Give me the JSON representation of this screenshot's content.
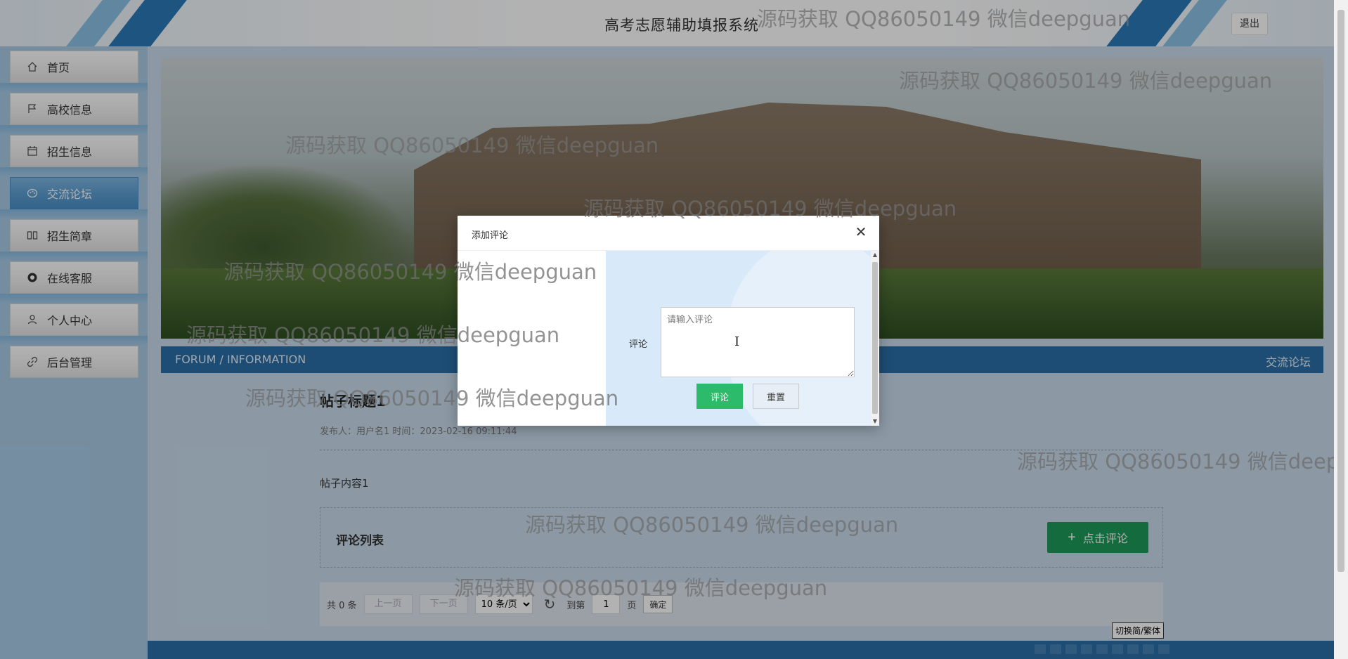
{
  "header": {
    "site_title": "高考志愿辅助填报系统",
    "logout_label": "退出"
  },
  "sidebar": {
    "items": [
      {
        "label": "首页",
        "icon": "home-icon",
        "active": false
      },
      {
        "label": "高校信息",
        "icon": "flag-icon",
        "active": false
      },
      {
        "label": "招生信息",
        "icon": "calendar-icon",
        "active": false
      },
      {
        "label": "交流论坛",
        "icon": "palette-icon",
        "active": true
      },
      {
        "label": "招生简章",
        "icon": "book-icon",
        "active": false
      },
      {
        "label": "在线客服",
        "icon": "chat-icon",
        "active": false
      },
      {
        "label": "个人中心",
        "icon": "user-icon",
        "active": false
      },
      {
        "label": "后台管理",
        "icon": "link-icon",
        "active": false
      }
    ]
  },
  "section": {
    "left_label": "FORUM / INFORMATION",
    "right_label": "交流论坛"
  },
  "post": {
    "title": "帖子标题1",
    "meta": "发布人：用户名1 时间：2023-02-16 09:11:44",
    "content": "帖子内容1"
  },
  "comments": {
    "list_label": "评论列表",
    "add_button_label": "点击评论"
  },
  "pager": {
    "total_label": "共 0 条",
    "prev_label": "上一页",
    "next_label": "下一页",
    "page_size_option": "10 条/页",
    "goto_label": "到第",
    "page_input": "1",
    "page_suffix": "页",
    "confirm_label": "确定"
  },
  "modal": {
    "title": "添加评论",
    "close_label": "✕",
    "field_label": "评论",
    "placeholder": "请输入评论",
    "submit_label": "评论",
    "reset_label": "重置"
  },
  "lang_switch_label": "切换简/繁体",
  "watermark_text": "源码获取 QQ86050149 微信deepguan",
  "watermarks": [
    {
      "text": "源码获取 QQ86050149 微信deepguan"
    },
    {
      "text": "源码获取 QQ86050149 微信deepguan"
    },
    {
      "text": "源码获取 QQ86050149 微信deepguan"
    },
    {
      "text": "源码获取 QQ86050149 微信deepguan"
    },
    {
      "text": "源码获取 QQ86050149 微信deepguan"
    },
    {
      "text": "源码获取 QQ86050149 微信deepguan"
    },
    {
      "text": "源码获取 QQ86050149 微信deepguan"
    },
    {
      "text": "源码获取 QQ86050149 微信deepguan"
    },
    {
      "text": "源码获取 QQ86050149 微信deepguan"
    }
  ],
  "colors": {
    "primary_blue": "#2a6fa6",
    "sidebar_bg": "#a9cbe6",
    "active_nav": "#5d9fd3",
    "green_button": "#1e9a5a",
    "submit_green": "#2bbb6a"
  }
}
